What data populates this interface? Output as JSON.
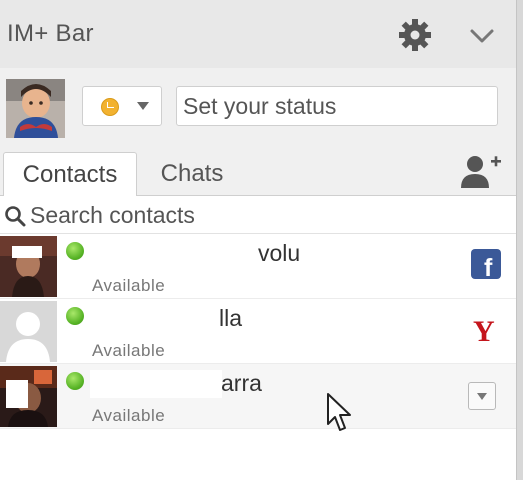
{
  "header": {
    "title": "IM+ Bar",
    "icons": {
      "settings": "gear-icon",
      "collapse": "chevron-down-icon"
    }
  },
  "status_bar": {
    "presence_icon": "away-clock-icon",
    "status_placeholder": "Set your status",
    "status_value": ""
  },
  "tabs": [
    {
      "label": "Contacts",
      "active": true
    },
    {
      "label": "Chats",
      "active": false
    }
  ],
  "add_contact_icon": "add-person-icon",
  "search": {
    "placeholder": "Search contacts",
    "value": ""
  },
  "contacts": [
    {
      "name_suffix": "volu",
      "status": "Available",
      "network": "facebook",
      "network_label": "f"
    },
    {
      "name_suffix": "lla",
      "status": "Available",
      "network": "yahoo",
      "network_label": "Y"
    },
    {
      "name_suffix": "arra",
      "status": "Available",
      "network": "menu"
    }
  ],
  "colors": {
    "header_bg": "#e8e8e8",
    "online": "#55b224",
    "away": "#f2b230",
    "facebook": "#3b5998",
    "yahoo": "#c4151c"
  }
}
